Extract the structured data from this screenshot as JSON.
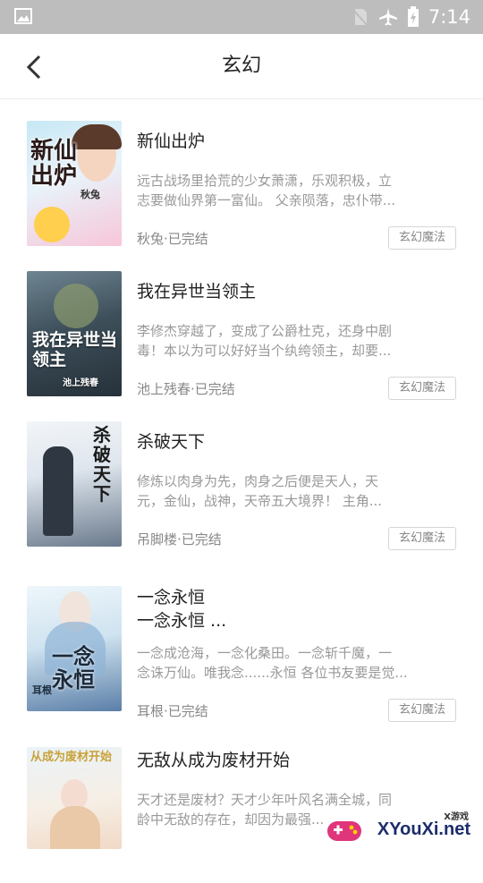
{
  "status_bar": {
    "time": "7:14",
    "icons": [
      "image-icon",
      "no-sim-icon",
      "airplane-icon",
      "battery-charging-icon"
    ]
  },
  "header": {
    "title": "玄幻",
    "back_icon": "chevron-left-icon"
  },
  "books": [
    {
      "title_line1": "新仙出炉",
      "title_line2": "",
      "desc_line1": "远古战场里拾荒的少女萧潇，乐观积极，立",
      "desc_line2": "志要做仙界第一富仙。 父亲陨落，忠仆带...",
      "meta": "秋兔·已完结",
      "tag": "玄幻魔法",
      "cover_text": "新仙出炉",
      "cover_author": "秋兔",
      "cover_colors": [
        "#c7e8f5",
        "#f7c6d9"
      ]
    },
    {
      "title_line1": "我在异世当领主",
      "title_line2": "",
      "desc_line1": "李修杰穿越了，变成了公爵杜克，还身中剧",
      "desc_line2": "毒！本以为可以好好当个纨绔领主，却要...",
      "meta": "池上残春·已完结",
      "tag": "玄幻魔法",
      "cover_text": "我在异世当领主",
      "cover_author": "池上残春",
      "cover_colors": [
        "#3d4f5a",
        "#8a9a6c"
      ]
    },
    {
      "title_line1": "杀破天下",
      "title_line2": "",
      "desc_line1": "修炼以肉身为先，肉身之后便是天人，天",
      "desc_line2": "元，金仙，战神，天帝五大境界！ 主角...",
      "meta": "吊脚楼·已完结",
      "tag": "玄幻魔法",
      "cover_text": "杀破天下",
      "cover_author": "",
      "cover_colors": [
        "#dfe6ee",
        "#6a7a8c"
      ]
    },
    {
      "title_line1": "一念永恒",
      "title_line2": "一念永恒 ...",
      "desc_line1": "一念成沧海，一念化桑田。一念斩千魔，一",
      "desc_line2": "念诛万仙。唯我念......永恒 各位书友要是觉...",
      "meta": "耳根·已完结",
      "tag": "玄幻魔法",
      "cover_text": "一念永恒",
      "cover_author": "耳根",
      "cover_colors": [
        "#cfe3f0",
        "#5b7fa8"
      ]
    },
    {
      "title_line1": "无敌从成为废材开始",
      "title_line2": "",
      "desc_line1": "天才还是废材？天才少年叶风名满全城，同",
      "desc_line2": "龄中无敌的存在，却因为最强...",
      "meta": "",
      "tag": "",
      "cover_text": "从成为废材开始",
      "cover_author": "",
      "cover_colors": [
        "#eaf3f8",
        "#f1d9c6"
      ]
    }
  ],
  "watermark": {
    "line1": "X游戏",
    "line2": "XYouXi.net"
  }
}
